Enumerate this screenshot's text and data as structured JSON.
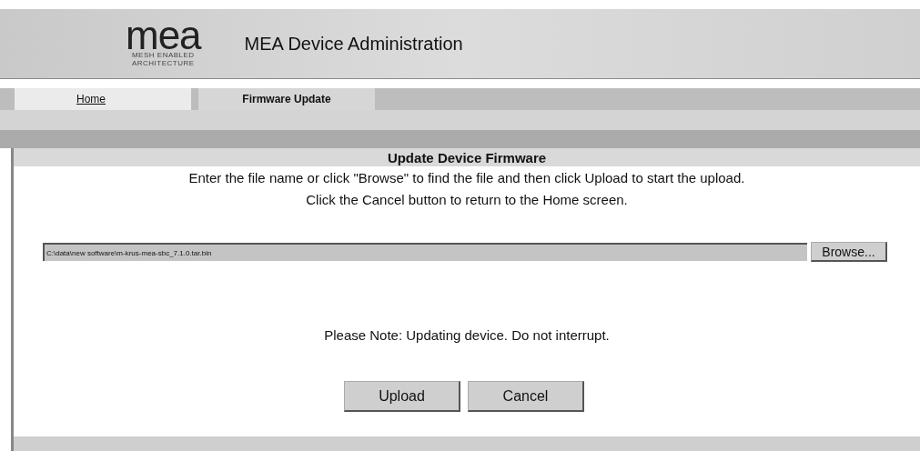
{
  "header": {
    "logo": {
      "wordmark": "mea",
      "tagline": [
        "MESH ENABLED",
        "ARCHITECTURE"
      ]
    },
    "title": "MEA Device Administration"
  },
  "tabs": [
    {
      "label": "Home",
      "selected": false
    },
    {
      "label": "Firmware Update",
      "selected": true
    }
  ],
  "panel": {
    "heading": "Update Device Firmware",
    "instructions": [
      "Enter the file name or click \"Browse\" to find the file and then click Upload to start the upload.",
      "Click the Cancel button to return to the Home screen."
    ],
    "file_field": {
      "value": "C:\\data\\new software\\m-krus-mea-sbc_7.1.0.tar.bin"
    },
    "browse_button": "Browse...",
    "note": "Please Note: Updating device. Do not interrupt.",
    "buttons": [
      "Upload",
      "Cancel"
    ]
  }
}
